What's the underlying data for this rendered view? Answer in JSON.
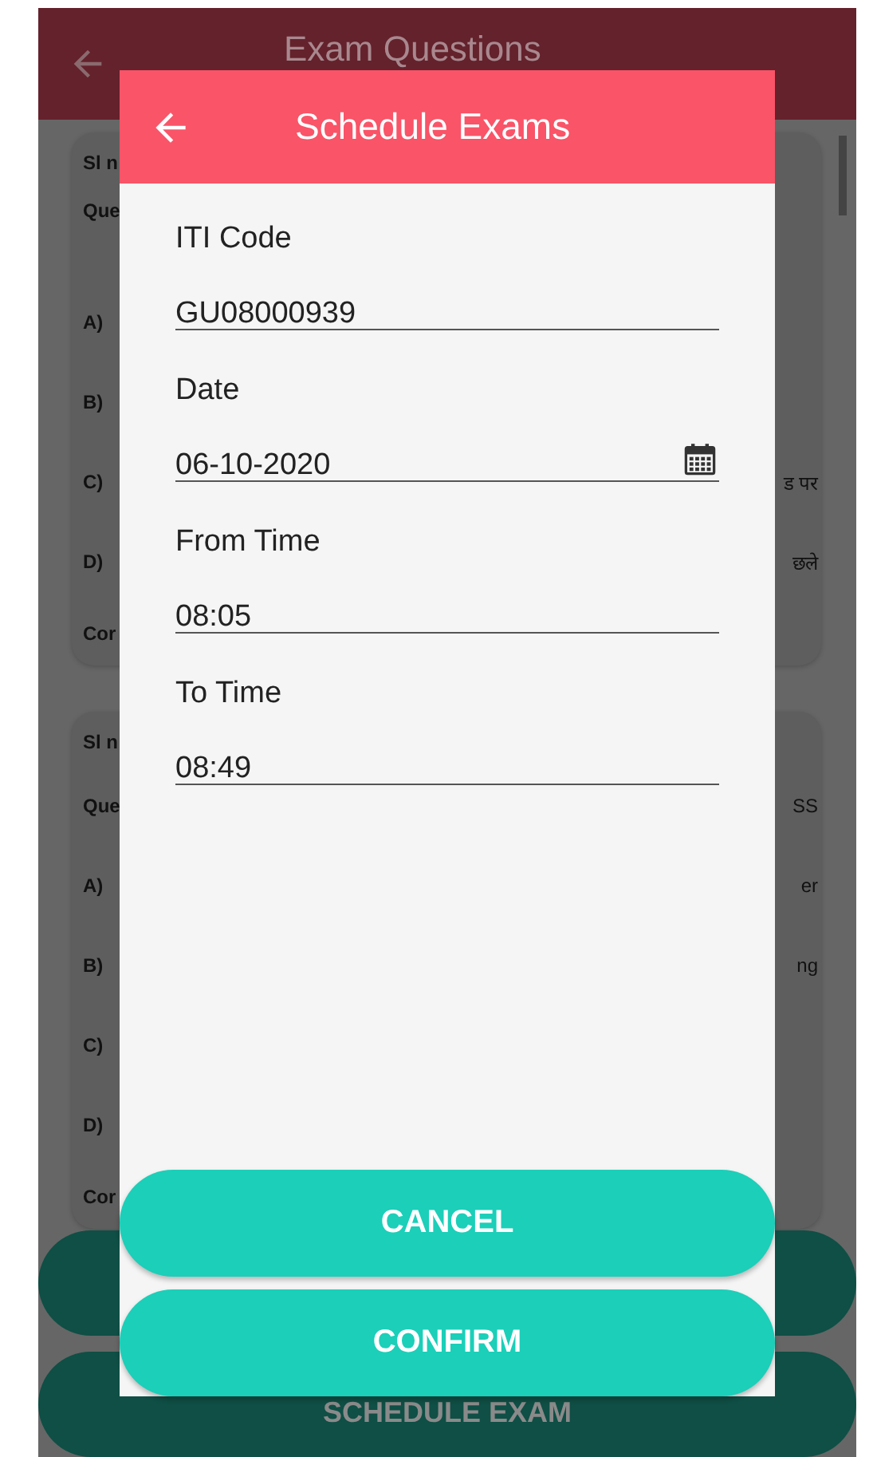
{
  "background_screen": {
    "title": "Exam Questions",
    "cards": [
      {
        "rows": [
          {
            "label": "Sl n"
          },
          {
            "label": "Que"
          },
          {
            "label": "A)"
          },
          {
            "label": "B)"
          },
          {
            "label": "C)",
            "value": "ड पर"
          },
          {
            "label": "D)",
            "value": "छले"
          },
          {
            "label": "Cor"
          }
        ]
      },
      {
        "rows": [
          {
            "label": "Sl n"
          },
          {
            "label": "Que",
            "value": "SS"
          },
          {
            "label": "A)",
            "value": "er"
          },
          {
            "label": "B)",
            "value": "ng"
          },
          {
            "label": "C)"
          },
          {
            "label": "D)"
          },
          {
            "label": "Cor"
          }
        ]
      }
    ],
    "schedule_button": "SCHEDULE EXAM"
  },
  "dialog": {
    "title": "Schedule Exams",
    "fields": [
      {
        "label": "ITI Code",
        "value": "GU08000939",
        "kind": "text"
      },
      {
        "label": "Date",
        "value": "06-10-2020",
        "kind": "date"
      },
      {
        "label": "From Time",
        "value": "08:05",
        "kind": "text"
      },
      {
        "label": "To Time",
        "value": "08:49",
        "kind": "text"
      }
    ],
    "buttons": [
      "CANCEL",
      "CONFIRM"
    ]
  }
}
